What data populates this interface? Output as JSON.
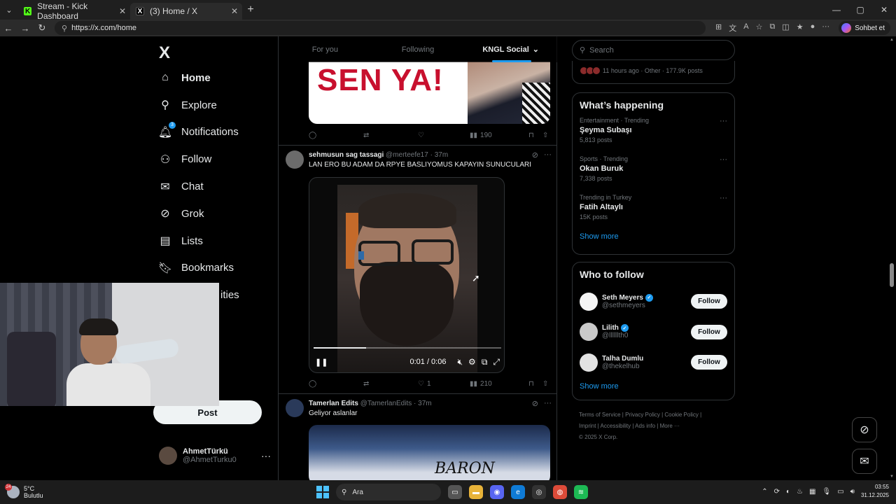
{
  "browser": {
    "tabs": [
      {
        "title": "Stream - Kick Dashboard",
        "icon": "kick-icon",
        "active": false
      },
      {
        "title": "(3) Home / X",
        "icon": "x-icon",
        "active": true
      }
    ],
    "url": "https://x.com/home",
    "copilot_label": "Sohbet et"
  },
  "sidebar": {
    "logo": "X",
    "items": [
      {
        "label": "Home",
        "icon": "home-icon",
        "bold": true
      },
      {
        "label": "Explore",
        "icon": "search-icon"
      },
      {
        "label": "Notifications",
        "icon": "bell-icon",
        "badge": "3"
      },
      {
        "label": "Follow",
        "icon": "person-add-icon"
      },
      {
        "label": "Chat",
        "icon": "mail-icon"
      },
      {
        "label": "Grok",
        "icon": "grok-icon"
      },
      {
        "label": "Lists",
        "icon": "list-icon"
      },
      {
        "label": "Bookmarks",
        "icon": "bookmark-icon"
      },
      {
        "label": "ities",
        "icon": "communities-icon"
      }
    ],
    "post_label": "Post",
    "profile": {
      "name": "AhmetTürkü",
      "handle": "@AhmetTurku0"
    }
  },
  "feed": {
    "tabs": [
      "For you",
      "Following",
      "KNGL Social"
    ],
    "active_tab": "KNGL Social",
    "post1": {
      "image_text": "SEN YA!",
      "views": "190"
    },
    "post2": {
      "name": "sehmusun sag tassagi",
      "handle": "@merteefe17",
      "time": "37m",
      "text": "LAN ERO BU ADAM DA RPYE BASLIYOMUS KAPAYIN SUNUCULARI",
      "video_time": "0:01 / 0:06",
      "video_progress": 0.28,
      "likes": "1",
      "views": "210"
    },
    "post3": {
      "name": "Tamerlan Edits",
      "handle": "@TamerlanEdits",
      "time": "37m",
      "text": "Geliyor aslanlar",
      "image_text": "BARON"
    }
  },
  "right": {
    "search_placeholder": "Search",
    "top_line": "11 hours ago · Other · 177.9K posts",
    "happening_title": "What’s happening",
    "trends": [
      {
        "category": "Entertainment · Trending",
        "title": "Şeyma Subaşı",
        "posts": "5,813 posts"
      },
      {
        "category": "Sports · Trending",
        "title": "Okan Buruk",
        "posts": "7,338 posts"
      },
      {
        "category": "Trending in Turkey",
        "title": "Fatih Altaylı",
        "posts": "15K posts"
      }
    ],
    "show_more": "Show more",
    "who_title": "Who to follow",
    "follows": [
      {
        "name": "Seth Meyers",
        "handle": "@sethmeyers",
        "verified": true
      },
      {
        "name": "Lilith",
        "handle": "@llllllth0",
        "verified": true
      },
      {
        "name": "Talha Dumlu",
        "handle": "@thekelhub",
        "verified": false
      }
    ],
    "follow_label": "Follow",
    "footer_line1": "Terms of Service  |  Privacy Policy  |  Cookie Policy  |",
    "footer_line2": "Imprint  |  Accessibility  |  Ads info  |  More ···",
    "footer_line3": "© 2025 X Corp."
  },
  "taskbar": {
    "temp": "5°C",
    "weather": "Bulutlu",
    "weather_badge": "24",
    "search_label": "Ara",
    "time": "03:55",
    "date": "31.12.2025"
  }
}
